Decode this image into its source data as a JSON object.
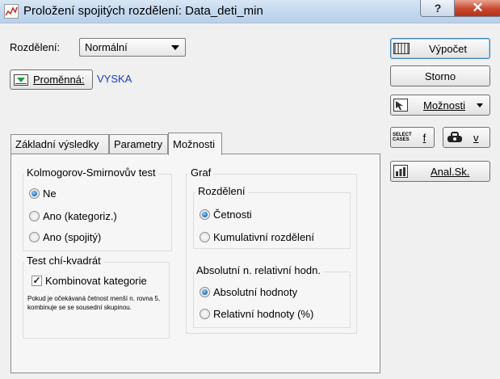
{
  "window": {
    "title": "Proložení spojitých rozdělení: Data_deti_min",
    "help_label": "?",
    "close_label": "✕"
  },
  "distribution": {
    "label": "Rozdělení:",
    "value": "Normální"
  },
  "variable": {
    "button_label": "Proměnná:",
    "value": "VYSKA"
  },
  "buttons": {
    "compute": "Výpočet",
    "cancel": "Storno",
    "options": "Možnosti",
    "select_cases_icon": "SELECT\nCASES",
    "select_cases_key": "f",
    "weight_key": "v",
    "analysis": "Anal.Sk."
  },
  "tabs": [
    {
      "label": "Základní výsledky",
      "active": false
    },
    {
      "label": "Parametry",
      "active": false
    },
    {
      "label": "Možnosti",
      "active": true
    }
  ],
  "ks_test": {
    "title": "Kolmogorov-Smirnovův test",
    "options": [
      {
        "label": "Ne",
        "selected": true
      },
      {
        "label": "Ano (kategoriz.)",
        "selected": false
      },
      {
        "label": "Ano (spojitý)",
        "selected": false
      }
    ]
  },
  "chi_test": {
    "title": "Test chí-kvadrát",
    "checkbox_label": "Kombinovat kategorie",
    "checked": true,
    "note": "Pokud je očekávaná četnost menší n. rovna 5, kombinuje se se sousední skupinou."
  },
  "graph": {
    "title": "Graf",
    "distribution": {
      "title": "Rozdělení",
      "options": [
        {
          "label": "Četnosti",
          "selected": true
        },
        {
          "label": "Kumulativní rozdělení",
          "selected": false
        }
      ]
    },
    "absolute": {
      "title": "Absolutní n. relativní hodn.",
      "options": [
        {
          "label": "Absolutní hodnoty",
          "selected": true
        },
        {
          "label": "Relativní hodnoty (%)",
          "selected": false
        }
      ]
    }
  },
  "colors": {
    "title_bar": "#c8dcf1",
    "close_button": "#c8472e",
    "variable_value": "#1a3ac8",
    "radio_selected": "#1f6fb8"
  }
}
